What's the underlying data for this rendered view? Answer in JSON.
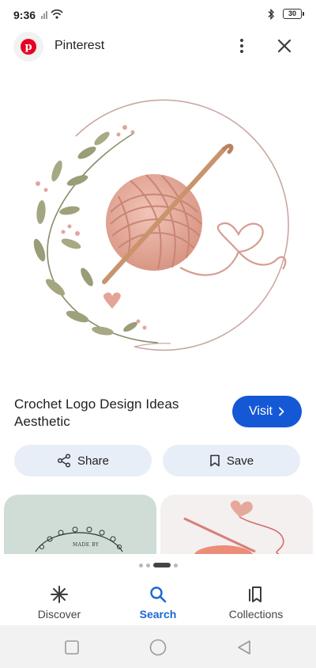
{
  "status_bar": {
    "time": "9:36",
    "battery": "30"
  },
  "header": {
    "site_name": "Pinterest"
  },
  "pin": {
    "title_line1": "Crochet Logo Design Ideas",
    "title_line2": "Aesthetic",
    "visit_label": "Visit"
  },
  "actions": {
    "share_label": "Share",
    "save_label": "Save"
  },
  "related": {
    "card1_text": "MADE BY"
  },
  "pager": {
    "count": 4,
    "active_index": 2
  },
  "bottom_nav": [
    {
      "label": "Discover",
      "icon": "asterisk-icon",
      "active": false
    },
    {
      "label": "Search",
      "icon": "search-icon",
      "active": true
    },
    {
      "label": "Collections",
      "icon": "collections-icon",
      "active": false
    }
  ],
  "colors": {
    "accent": "#1558d6",
    "pill_bg": "#e8eef8",
    "active_nav": "#1a67d2",
    "pinterest_red": "#e60023"
  }
}
